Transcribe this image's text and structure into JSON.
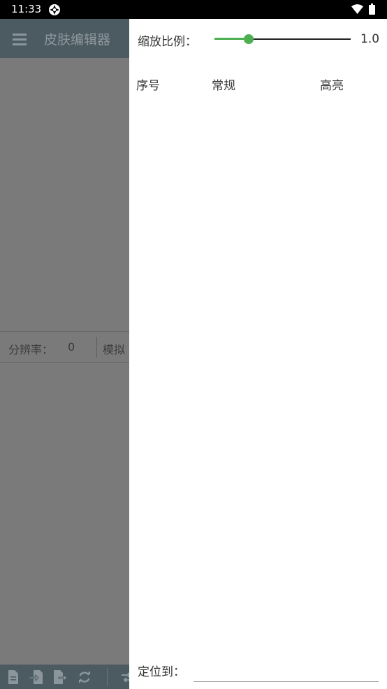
{
  "status_bar": {
    "time": "11:33",
    "app_icon": "aperture-icon",
    "wifi_icon": "wifi-icon",
    "battery_icon": "battery-icon"
  },
  "app": {
    "menu_icon": "hamburger-menu-icon",
    "title": "皮肤编辑器",
    "resolution_label": "分辨率：",
    "resolution_value": "0",
    "mode_label": "模拟",
    "bottom_icons": [
      "new-file-icon",
      "import-icon",
      "export-icon",
      "refresh-icon",
      "swap-icon"
    ]
  },
  "drawer": {
    "scale_label": "缩放比例：",
    "scale_value": "1.0",
    "scale_fraction": 0.25,
    "columns": [
      "序号",
      "常规",
      "高亮"
    ],
    "locate_label": "定位到：",
    "locate_value": "",
    "accent_color": "#4caf50"
  }
}
